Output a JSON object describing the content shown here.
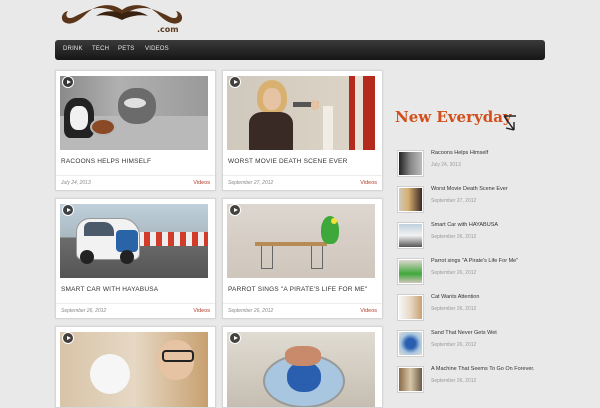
{
  "header": {
    "logo_suffix": ".com"
  },
  "nav": {
    "items": [
      "DRINK",
      "TECH",
      "PETS",
      "VIDEOS"
    ]
  },
  "posts": [
    {
      "title": "RACOONS HELPS HIMSELF",
      "date": "July 24, 2013",
      "category": "Videos"
    },
    {
      "title": "WORST MOVIE DEATH SCENE EVER",
      "date": "September 27, 2012",
      "category": "Videos"
    },
    {
      "title": "SMART CAR WITH HAYABUSA",
      "date": "September 26, 2012",
      "category": "Videos"
    },
    {
      "title": "PARROT SINGS \"A PIRATE'S LIFE FOR ME\"",
      "date": "September 26, 2012",
      "category": "Videos"
    }
  ],
  "sidebar": {
    "title": "New Everyday",
    "items": [
      {
        "title": "Racoons Helps Himself",
        "date": "July 24, 2013"
      },
      {
        "title": "Worst Movie Death Scene Ever",
        "date": "September 27, 2012"
      },
      {
        "title": "Smart Car with HAYABUSA",
        "date": "September 26, 2012"
      },
      {
        "title": "Parrot sings \"A Pirate's Life For Me\"",
        "date": "September 26, 2012"
      },
      {
        "title": "Cat Wants Attention",
        "date": "September 26, 2012"
      },
      {
        "title": "Sand That Never Gets Wet",
        "date": "September 26, 2012"
      },
      {
        "title": "A Machine That Seems To Go On Forever.",
        "date": "September 26, 2012"
      }
    ]
  }
}
